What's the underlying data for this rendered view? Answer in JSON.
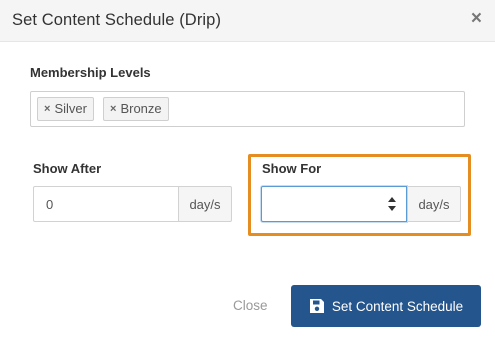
{
  "modal": {
    "title": "Set Content Schedule (Drip)",
    "close_icon": "×"
  },
  "levels": {
    "label": "Membership Levels",
    "chips": [
      {
        "remove_icon": "×",
        "label": "Silver"
      },
      {
        "remove_icon": "×",
        "label": "Bronze"
      }
    ]
  },
  "show_after": {
    "label": "Show After",
    "value": "0",
    "unit": "day/s"
  },
  "show_for": {
    "label": "Show For",
    "value": "",
    "unit": "day/s"
  },
  "footer": {
    "close_label": "Close",
    "primary_label": "Set Content Schedule",
    "primary_icon": "floppy-disk-icon"
  },
  "colors": {
    "primary": "#24558c",
    "highlight": "#e58d20",
    "focus": "#5b9bd5"
  }
}
